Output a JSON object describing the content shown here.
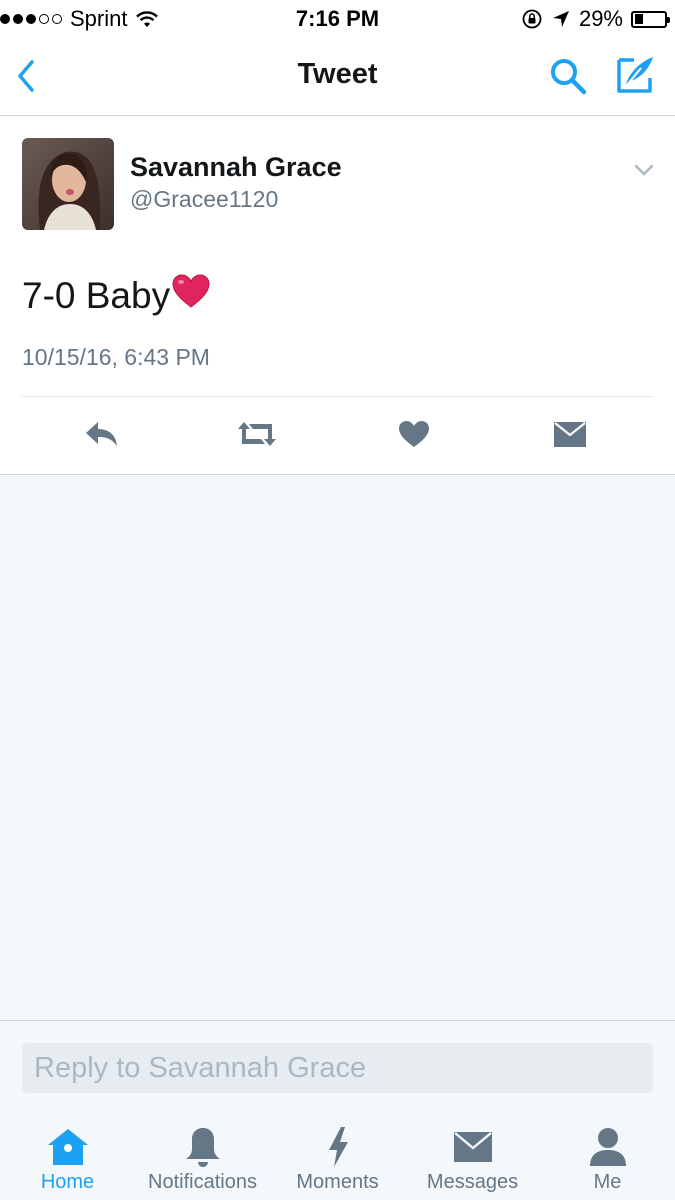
{
  "status_bar": {
    "carrier": "Sprint",
    "signal_dots_filled": 3,
    "signal_dots_total": 5,
    "time": "7:16 PM",
    "battery": "29%",
    "battery_level": 0.29
  },
  "nav": {
    "title": "Tweet",
    "back_icon": "chevron-left-icon",
    "search_icon": "search-icon",
    "compose_icon": "compose-tweet-icon"
  },
  "tweet": {
    "display_name": "Savannah Grace",
    "handle": "@Gracee1120",
    "text": "7-0 Baby",
    "emoji": "❤️",
    "timestamp": "10/15/16, 6:43 PM"
  },
  "reply": {
    "placeholder": "Reply to Savannah Grace"
  },
  "tabs": [
    {
      "label": "Home",
      "icon": "home-icon",
      "active": true
    },
    {
      "label": "Notifications",
      "icon": "bell-icon",
      "active": false
    },
    {
      "label": "Moments",
      "icon": "lightning-icon",
      "active": false
    },
    {
      "label": "Messages",
      "icon": "envelope-icon",
      "active": false
    },
    {
      "label": "Me",
      "icon": "person-icon",
      "active": false
    }
  ],
  "colors": {
    "accent": "#1da1f2",
    "icon_gray": "#657786",
    "background": "#f5f8fa",
    "heart_red": "#e0245e"
  }
}
